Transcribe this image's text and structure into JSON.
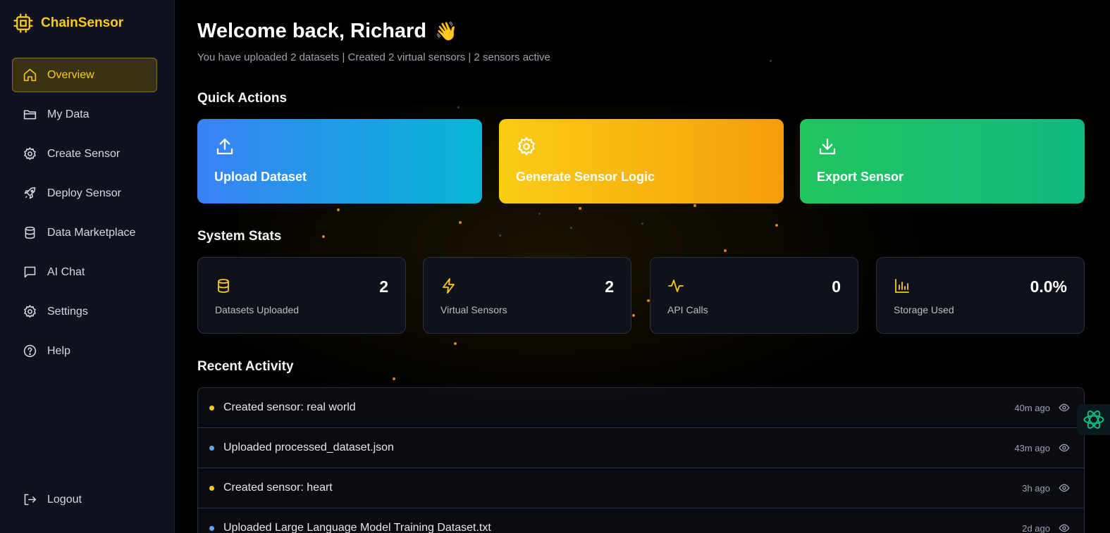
{
  "brand": {
    "name": "ChainSensor",
    "icon": "chip-icon",
    "accent": "#facc15"
  },
  "sidebar": {
    "items": [
      {
        "label": "Overview",
        "icon": "home-icon",
        "active": true
      },
      {
        "label": "My Data",
        "icon": "folder-icon"
      },
      {
        "label": "Create Sensor",
        "icon": "gear-icon"
      },
      {
        "label": "Deploy Sensor",
        "icon": "rocket-icon"
      },
      {
        "label": "Data Marketplace",
        "icon": "database-icon"
      },
      {
        "label": "AI Chat",
        "icon": "chat-icon"
      },
      {
        "label": "Settings",
        "icon": "gear-icon"
      },
      {
        "label": "Help",
        "icon": "help-icon"
      }
    ],
    "logout": {
      "label": "Logout",
      "icon": "logout-icon"
    }
  },
  "header": {
    "welcome": "Welcome back, Richard",
    "emoji": "👋",
    "subtitle": "You have uploaded 2 datasets | Created 2 virtual sensors | 2 sensors active"
  },
  "quick_actions": {
    "title": "Quick Actions",
    "items": [
      {
        "label": "Upload Dataset",
        "icon": "upload-icon",
        "color": "#3b82f6"
      },
      {
        "label": "Generate Sensor Logic",
        "icon": "gear-icon",
        "color": "#facc15"
      },
      {
        "label": "Export Sensor",
        "icon": "download-icon",
        "color": "#22c55e"
      }
    ]
  },
  "system_stats": {
    "title": "System Stats",
    "items": [
      {
        "label": "Datasets Uploaded",
        "value": "2",
        "icon": "database-icon"
      },
      {
        "label": "Virtual Sensors",
        "value": "2",
        "icon": "lightning-icon"
      },
      {
        "label": "API Calls",
        "value": "0",
        "icon": "activity-icon"
      },
      {
        "label": "Storage Used",
        "value": "0.0%",
        "icon": "bar-chart-icon"
      }
    ]
  },
  "recent_activity": {
    "title": "Recent Activity",
    "items": [
      {
        "text": "Created sensor: real world",
        "time": "40m ago",
        "dot_color": "#facc15"
      },
      {
        "text": "Uploaded processed_dataset.json",
        "time": "43m ago",
        "dot_color": "#60a5fa"
      },
      {
        "text": "Created sensor: heart",
        "time": "3h ago",
        "dot_color": "#facc15"
      },
      {
        "text": "Uploaded Large Language Model Training Dataset.txt",
        "time": "2d ago",
        "dot_color": "#60a5fa"
      }
    ]
  },
  "floating_button": {
    "icon": "ai-assistant-icon"
  }
}
